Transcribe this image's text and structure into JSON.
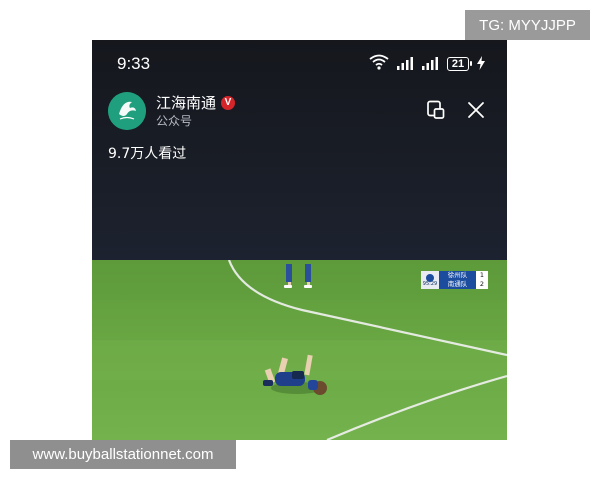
{
  "watermark_top": "TG: MYYJJPP",
  "status_bar": {
    "time": "9:33",
    "battery": "21",
    "icons": [
      "wifi-icon",
      "signal-icon",
      "signal-icon",
      "battery-icon",
      "charging-icon"
    ]
  },
  "account": {
    "name": "江海南通",
    "verified_badge": "V",
    "type": "公众号",
    "avatar_icon": "account-logo-icon",
    "avatar_color": "#1f9f7d",
    "badge_color": "#d5252a"
  },
  "actions": {
    "pip_icon": "picture-in-picture-icon",
    "close_icon": "close-icon"
  },
  "view_count": "9.7万人看过",
  "video": {
    "scoreboard": {
      "clock": "95:29",
      "home": {
        "team": "徐州队",
        "score": "1",
        "color": "#1b4c9e"
      },
      "away": {
        "team": "南通队",
        "score": "2",
        "color": "#1b4c9e"
      }
    }
  },
  "site_watermark": "www.buyballstationnet.com"
}
